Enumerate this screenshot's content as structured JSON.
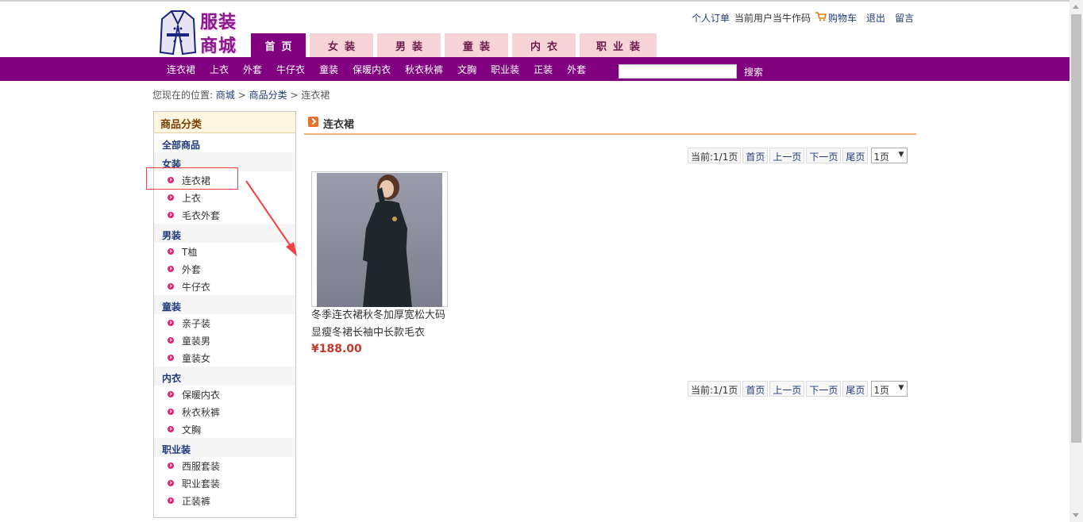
{
  "brand": {
    "line1": "服装",
    "line2": "商城"
  },
  "toplinks": {
    "orders": "个人订单",
    "current_user": "当前用户当牛作码",
    "cart": "购物车",
    "logout": "退出",
    "message": "留言"
  },
  "nav_tabs": [
    "首页",
    "女装",
    "男装",
    "童装",
    "内衣",
    "职业装"
  ],
  "subnav": {
    "items": [
      "连衣裙",
      "上衣",
      "外套",
      "牛仔衣",
      "童装",
      "保暖内衣",
      "秋衣秋裤",
      "文胸",
      "职业装",
      "正装",
      "外套"
    ],
    "search_value": "",
    "search_button": "搜索"
  },
  "breadcrumb": {
    "prefix": "您现在的位置:",
    "items": [
      "商城",
      "商品分类",
      "连衣裙"
    ],
    "separator": ">"
  },
  "sidebar": {
    "title": "商品分类",
    "all": "全部商品",
    "groups": [
      {
        "name": "女装",
        "items": [
          "连衣裙",
          "上衣",
          "毛衣外套"
        ]
      },
      {
        "name": "男装",
        "items": [
          "T桖",
          "外套",
          "牛仔衣"
        ]
      },
      {
        "name": "童装",
        "items": [
          "亲子装",
          "童装男",
          "童装女"
        ]
      },
      {
        "name": "内衣",
        "items": [
          "保暖内衣",
          "秋衣秋裤",
          "文胸"
        ]
      },
      {
        "name": "职业装",
        "items": [
          "西服套装",
          "职业套装",
          "正装裤"
        ]
      }
    ]
  },
  "main": {
    "title": "连衣裙"
  },
  "pager": {
    "current": "当前:1/1页",
    "first": "首页",
    "prev": "上一页",
    "next": "下一页",
    "last": "尾页",
    "select": "1页"
  },
  "product": {
    "name": "冬季连衣裙秋冬加厚宽松大码显瘦冬裙长袖中长款毛衣",
    "price": "¥188.00"
  },
  "colors": {
    "brand_purple": "#800080",
    "tab_pink": "#f5d3d7",
    "price_red": "#c0392b",
    "link_blue": "#1f3a7a",
    "annotation_red": "#f04040"
  }
}
